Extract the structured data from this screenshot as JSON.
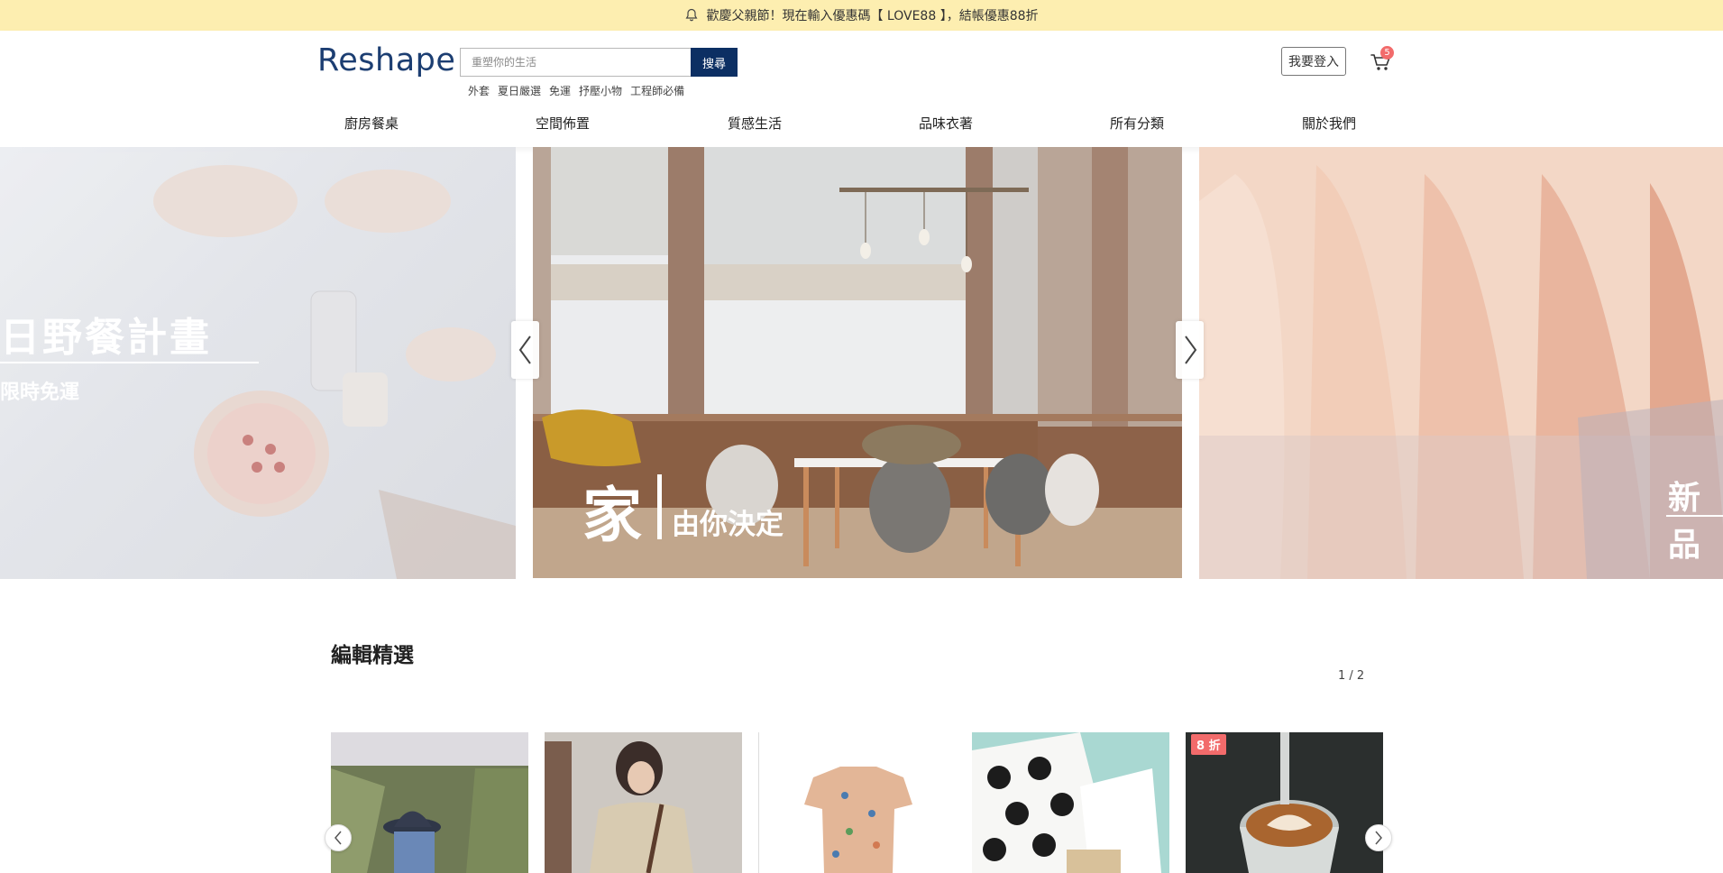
{
  "announcement": {
    "text": "歡慶父親節！現在輸入優惠碼【 LOVE88 】，結帳優惠88折",
    "icon": "bell-icon"
  },
  "header": {
    "logo": "Reshape",
    "search": {
      "placeholder": "重塑你的生活",
      "button": "搜尋"
    },
    "hot_tags": [
      "外套",
      "夏日嚴選",
      "免運",
      "抒壓小物",
      "工程師必備"
    ],
    "login": "我要登入",
    "cart": {
      "icon": "cart-icon",
      "count": "5"
    }
  },
  "nav": [
    "廚房餐桌",
    "空間佈置",
    "質感生活",
    "品味衣著",
    "所有分類",
    "關於我們"
  ],
  "hero": {
    "left": {
      "title": "日野餐計畫",
      "subtitle": "限時免運"
    },
    "center": {
      "big": "家",
      "small": "由你決定"
    },
    "right": {
      "title": "新品"
    }
  },
  "section": {
    "title": "編輯精選",
    "pager": "1 / 2"
  },
  "cards": [
    {
      "badge": ""
    },
    {
      "badge": ""
    },
    {
      "badge": ""
    },
    {
      "badge": ""
    },
    {
      "badge": "8 折"
    }
  ],
  "colors": {
    "brand": "#1c3e72",
    "search_button": "#0c2f63",
    "announcement_bg": "#fdeeb0",
    "badge": "#f26b6b"
  }
}
